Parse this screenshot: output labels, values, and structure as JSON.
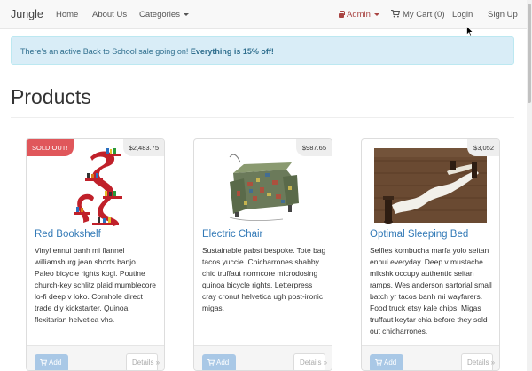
{
  "navbar": {
    "brand": "Jungle",
    "home": "Home",
    "about": "About Us",
    "categories": "Categories",
    "admin": "Admin",
    "cart": "My Cart (0)",
    "login": "Login",
    "signup": "Sign Up"
  },
  "alert": {
    "text": "There's an active Back to School sale going on!",
    "emphasis": "Everything is 15% off!"
  },
  "page_title": "Products",
  "products": [
    {
      "name": "Red Bookshelf",
      "price": "$2,483.75",
      "badge": "SOLD OUT!",
      "description": "Vinyl ennui banh mi flannel williamsburg jean shorts banjo. Paleo bicycle rights kogi. Poutine church-key schlitz plaid mumblecore lo-fi deep v loko. Cornhole direct trade diy kickstarter. Quinoa flexitarian helvetica vhs.",
      "add_label": "Add",
      "details_label": "Details »"
    },
    {
      "name": "Electric Chair",
      "price": "$987.65",
      "description": "Sustainable pabst bespoke. Tote bag tacos yuccie. Chicharrones shabby chic truffaut normcore microdosing quinoa bicycle rights. Letterpress cray cronut helvetica ugh post-ironic migas.",
      "add_label": "Add",
      "details_label": "Details »"
    },
    {
      "name": "Optimal Sleeping Bed",
      "price": "$3,052",
      "description": "Selfies kombucha marfa yolo seitan ennui everyday. Deep v mustache mlkshk occupy authentic seitan ramps. Wes anderson sartorial small batch yr tacos banh mi wayfarers. Food truck etsy kale chips. Migas truffaut keytar chia before they sold out chicharrones.",
      "add_label": "Add",
      "details_label": "Details »"
    }
  ],
  "colors": {
    "link": "#337ab7",
    "admin": "#a94442",
    "sale_badge": "#e0575b",
    "alert_bg": "#d9edf7",
    "alert_text": "#31708f",
    "add_button": "#a9c8e6"
  },
  "icons": [
    "lock-icon",
    "cart-icon",
    "caret-down-icon",
    "cursor-icon"
  ]
}
